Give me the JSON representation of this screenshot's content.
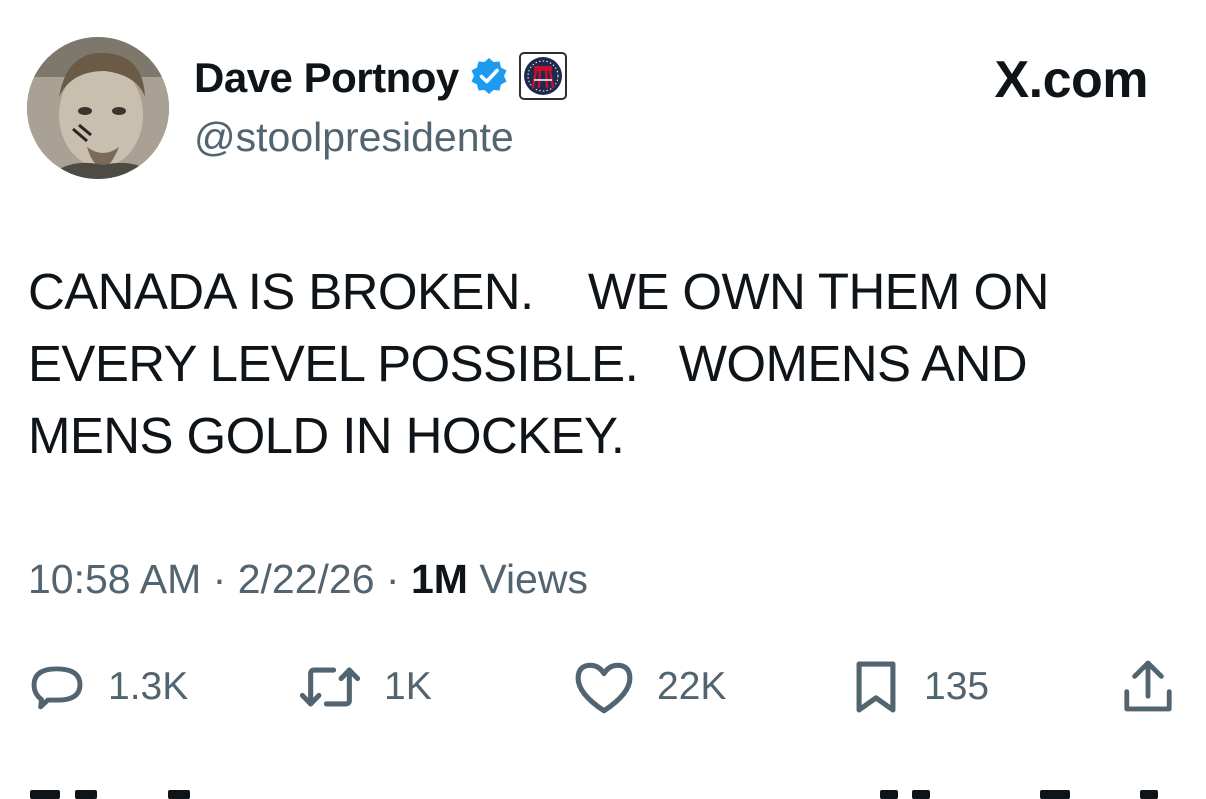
{
  "author": {
    "display_name": "Dave Portnoy",
    "handle": "@stoolpresidente",
    "verified": true,
    "verified_color": "#1d9bf0",
    "affiliate_badge": "barstool-sports-badge"
  },
  "site": {
    "label": "X.com"
  },
  "tweet": {
    "text": "CANADA IS BROKEN.    WE OWN THEM ON\nEVERY LEVEL POSSIBLE.   WOMENS AND\nMENS GOLD IN HOCKEY.",
    "time": "10:58 AM",
    "date": "2/22/26",
    "separator": "·",
    "views_count": "1M",
    "views_label": "Views"
  },
  "actions": {
    "replies": "1.3K",
    "reposts": "1K",
    "likes": "22K",
    "bookmarks": "135"
  },
  "icons": [
    "avatar",
    "verified-badge-icon",
    "barstool-badge-icon",
    "reply-icon",
    "repost-icon",
    "like-icon",
    "bookmark-icon",
    "share-icon"
  ],
  "colors": {
    "text": "#0f1419",
    "secondary": "#536471",
    "accent": "#1d9bf0",
    "badge_red": "#c8102e",
    "badge_navy": "#1d2a4d"
  }
}
